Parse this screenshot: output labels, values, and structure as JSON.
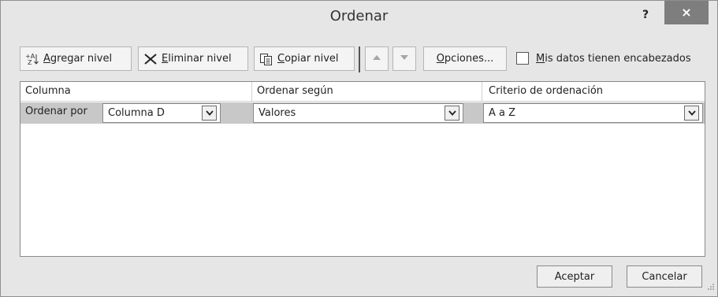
{
  "dialog": {
    "title": "Ordenar",
    "help_label": "?",
    "close_label": "×"
  },
  "toolbar": {
    "add_level": {
      "accel": "A",
      "rest": "gregar nivel",
      "icon": "sort-az-icon"
    },
    "delete_level": {
      "accel": "E",
      "rest": "liminar nivel",
      "icon": "delete-x-icon"
    },
    "copy_level": {
      "accel": "C",
      "rest": "opiar nivel",
      "icon": "copy-icon"
    },
    "move_up": {
      "icon": "triangle-up-icon"
    },
    "move_down": {
      "icon": "triangle-down-icon"
    },
    "options": {
      "accel": "O",
      "rest": "pciones..."
    },
    "headers_checkbox": {
      "accel": "M",
      "rest": "is datos tienen encabezados",
      "checked": false
    }
  },
  "grid": {
    "headers": [
      "Columna",
      "Ordenar según",
      "Criterio de ordenación"
    ],
    "rows": [
      {
        "label": "Ordenar por",
        "column": "Columna D",
        "sort_on": "Valores",
        "order": "A a Z"
      }
    ]
  },
  "footer": {
    "ok_label": "Aceptar",
    "cancel_label": "Cancelar"
  },
  "colors": {
    "dialog_bg": "#e6e6e6",
    "close_button": "#7e7e7e",
    "selected_row": "#c8c8c8"
  }
}
